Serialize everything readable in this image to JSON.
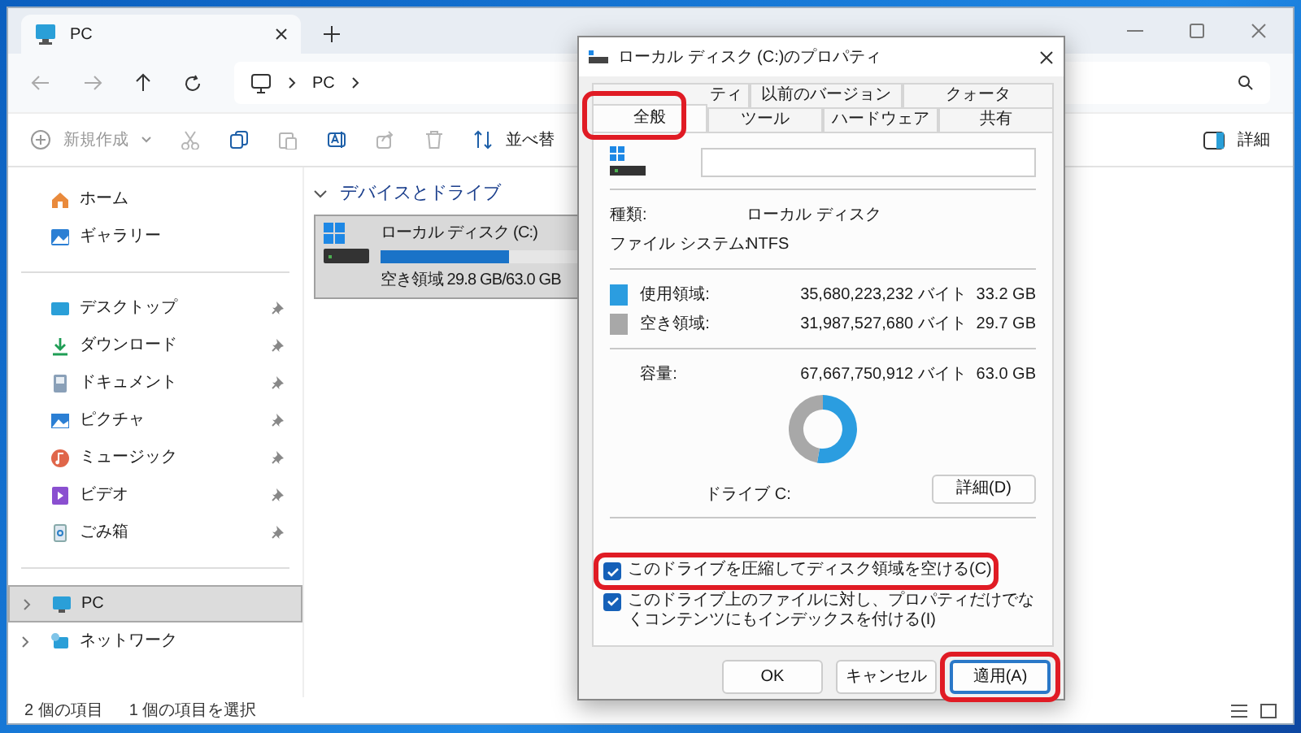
{
  "explorer": {
    "tab": {
      "title": "PC"
    },
    "address": {
      "crumbs": [
        "PC"
      ]
    },
    "toolbar": {
      "new_label": "新規作成",
      "new_disabled": true,
      "tools": [
        {
          "disabled": true
        },
        {
          "disabled": false
        },
        {
          "disabled": true
        },
        {
          "disabled": false
        },
        {
          "disabled": true
        },
        {
          "disabled": true
        }
      ],
      "sort_label": "並べ替",
      "details_label": "詳細"
    },
    "sidebar": {
      "groups": [
        [
          {
            "label": "ホーム",
            "pinned": false,
            "selected": false,
            "expandable": false
          },
          {
            "label": "ギャラリー",
            "pinned": false,
            "selected": false,
            "expandable": false
          }
        ],
        [
          {
            "label": "デスクトップ",
            "pinned": true,
            "selected": false,
            "expandable": false
          },
          {
            "label": "ダウンロード",
            "pinned": true,
            "selected": false,
            "expandable": false
          },
          {
            "label": "ドキュメント",
            "pinned": true,
            "selected": false,
            "expandable": false
          },
          {
            "label": "ピクチャ",
            "pinned": true,
            "selected": false,
            "expandable": false
          },
          {
            "label": "ミュージック",
            "pinned": true,
            "selected": false,
            "expandable": false
          },
          {
            "label": "ビデオ",
            "pinned": true,
            "selected": false,
            "expandable": false
          },
          {
            "label": "ごみ箱",
            "pinned": true,
            "selected": false,
            "expandable": false
          }
        ],
        [
          {
            "label": "PC",
            "pinned": false,
            "selected": true,
            "expandable": true
          },
          {
            "label": "ネットワーク",
            "pinned": false,
            "selected": false,
            "expandable": true
          }
        ]
      ]
    },
    "section": {
      "title": "デバイスとドライブ",
      "expanded": true
    },
    "drive": {
      "name": "ローカル ディスク (C:)",
      "level": 0.527,
      "free_text": "空き領域 29.8 GB/63.0 GB",
      "selected": true
    },
    "status_bar": [
      "2 個の項目",
      "1 個の項目を選択"
    ]
  },
  "dialog": {
    "title": "ローカル ディスク (C:)のプロパティ",
    "tab_rows": [
      [
        {
          "label": "ティ",
          "selected": false
        },
        {
          "label": "以前のバージョン",
          "selected": false
        },
        {
          "label": "クォータ",
          "selected": false
        }
      ],
      [
        {
          "label": "全般",
          "selected": true,
          "highlighted": true
        },
        {
          "label": "ツール",
          "selected": false
        },
        {
          "label": "ハードウェア",
          "selected": false
        },
        {
          "label": "共有",
          "selected": false
        }
      ]
    ],
    "info": [
      {
        "label": "種類:",
        "value": "ローカル ディスク"
      },
      {
        "label": "ファイル システム:",
        "value": "NTFS"
      }
    ],
    "usage": [
      {
        "label": "使用領域:",
        "bytes": "35,680,223,232 バイト",
        "size": "33.2 GB",
        "color": "#2b9de0"
      },
      {
        "label": "空き領域:",
        "bytes": "31,987,527,680 バイト",
        "size": "29.7 GB",
        "color": "#a8a8a8"
      }
    ],
    "capacity": {
      "label": "容量:",
      "bytes": "67,667,750,912 バイト",
      "size": "63.0 GB"
    },
    "chart_data": {
      "type": "donut",
      "values": [
        52.7,
        47.3
      ]
    },
    "drive_label": "ドライブ C:",
    "details_button": "詳細(D)",
    "checkboxes": [
      {
        "label": "このドライブを圧縮してディスク領域を空ける(C)",
        "checked": true,
        "highlighted": true
      },
      {
        "label": "このドライブ上のファイルに対し、プロパティだけでなくコンテンツにもインデックスを付ける(I)",
        "checked": true
      }
    ],
    "buttons": [
      {
        "label": "OK",
        "default": false
      },
      {
        "label": "キャンセル",
        "default": false
      },
      {
        "label": "適用(A)",
        "default": true,
        "highlighted": true
      }
    ]
  }
}
